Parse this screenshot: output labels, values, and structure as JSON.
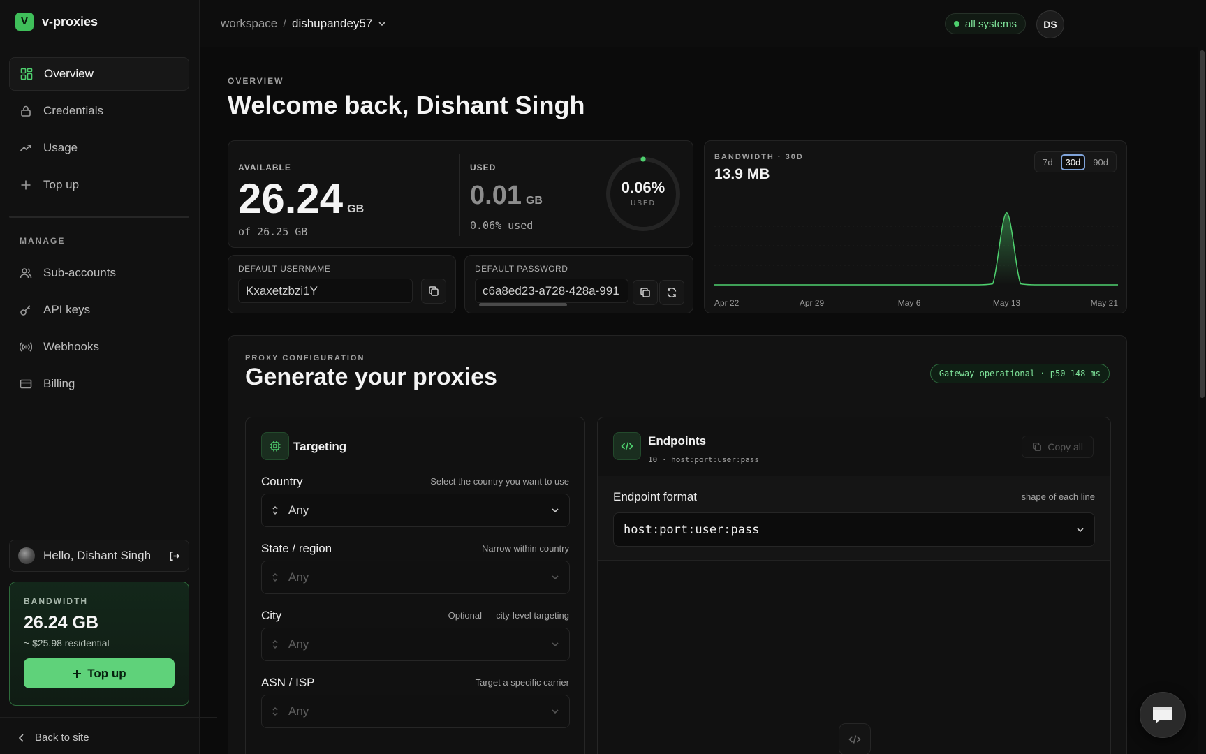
{
  "brand": {
    "logo_letter": "V",
    "name": "v-proxies",
    "accent": "#3fbf5a"
  },
  "sidebar": {
    "items": [
      {
        "label": "Overview",
        "icon": "grid-icon",
        "active": true
      },
      {
        "label": "Credentials",
        "icon": "lock-icon"
      },
      {
        "label": "Usage",
        "icon": "trend-icon"
      },
      {
        "label": "Top up",
        "icon": "plus-icon"
      }
    ],
    "manage_label": "MANAGE",
    "manage_items": [
      {
        "label": "Sub-accounts",
        "icon": "users-icon"
      },
      {
        "label": "API keys",
        "icon": "key-icon"
      },
      {
        "label": "Webhooks",
        "icon": "broadcast-icon"
      },
      {
        "label": "Billing",
        "icon": "card-icon"
      }
    ],
    "user_greeting": "Hello, Dishant Singh",
    "bandwidth": {
      "label": "BANDWIDTH",
      "value": "26.24 GB",
      "sub": "~ $25.98 residential",
      "topup_label": "Top up"
    },
    "back_label": "Back to site"
  },
  "topbar": {
    "crumb_root": "workspace",
    "crumb_sep": "/",
    "crumb_current": "dishupandey57",
    "status_label": "all systems",
    "status_color": "#4ed06e",
    "avatar_initials": "DS"
  },
  "page": {
    "eyebrow": "OVERVIEW",
    "title": "Welcome back, Dishant Singh"
  },
  "stats": {
    "available_label": "AVAILABLE",
    "available_value": "26.24",
    "available_unit": "GB",
    "available_sub": "of 26.25 GB",
    "used_label": "USED",
    "used_value": "0.01",
    "used_unit": "GB",
    "used_sub": "0.06% used",
    "gauge_value": "0.06%",
    "gauge_label": "USED",
    "gauge_fraction": 0.0006
  },
  "credentials": {
    "username_label": "DEFAULT USERNAME",
    "username_value": "Kxaxetzbzi1Y",
    "password_label": "DEFAULT PASSWORD",
    "password_value": "c6a8ed23-a728-428a-991"
  },
  "bandwidth_chart": {
    "eyebrow": "BANDWIDTH · 30D",
    "total": "13.9 MB",
    "ranges": [
      "7d",
      "30d",
      "90d"
    ],
    "active_range": "30d",
    "line_color": "#4ed06e"
  },
  "chart_data": {
    "type": "area",
    "title": "BANDWIDTH · 30D",
    "x_tick_labels": [
      "Apr 22",
      "Apr 29",
      "May 6",
      "May 13",
      "May 21"
    ],
    "x": [
      "Apr 22",
      "Apr 23",
      "Apr 24",
      "Apr 25",
      "Apr 26",
      "Apr 27",
      "Apr 28",
      "Apr 29",
      "Apr 30",
      "May 1",
      "May 2",
      "May 3",
      "May 4",
      "May 5",
      "May 6",
      "May 7",
      "May 8",
      "May 9",
      "May 10",
      "May 11",
      "May 12",
      "May 13",
      "May 14",
      "May 15",
      "May 16",
      "May 17",
      "May 18",
      "May 19",
      "May 20",
      "May 21"
    ],
    "series": [
      {
        "values": [
          0,
          0,
          0,
          0,
          0,
          0,
          0,
          0,
          0,
          0,
          0,
          0,
          0,
          0,
          0,
          0,
          0,
          0,
          0,
          0,
          0.2,
          13.9,
          0.2,
          0,
          0,
          0,
          0,
          0,
          0,
          0
        ]
      }
    ],
    "ylim": [
      0,
      14
    ],
    "grid": true
  },
  "proxy": {
    "eyebrow": "PROXY CONFIGURATION",
    "title": "Generate your proxies",
    "gateway_status": "Gateway operational · p50 148 ms",
    "targeting": {
      "title": "Targeting",
      "fields": [
        {
          "label": "Country",
          "hint": "Select the country you want to use",
          "value": "Any",
          "disabled": false
        },
        {
          "label": "State / region",
          "hint": "Narrow within country",
          "value": "Any",
          "disabled": true
        },
        {
          "label": "City",
          "hint": "Optional — city-level targeting",
          "value": "Any",
          "disabled": true
        },
        {
          "label": "ASN / ISP",
          "hint": "Target a specific carrier",
          "value": "Any",
          "disabled": true
        }
      ]
    },
    "endpoints": {
      "title": "Endpoints",
      "sub": "10 · host:port:user:pass",
      "copy_all": "Copy all",
      "format_label": "Endpoint format",
      "format_hint": "shape of each line",
      "format_value": "host:port:user:pass"
    }
  }
}
